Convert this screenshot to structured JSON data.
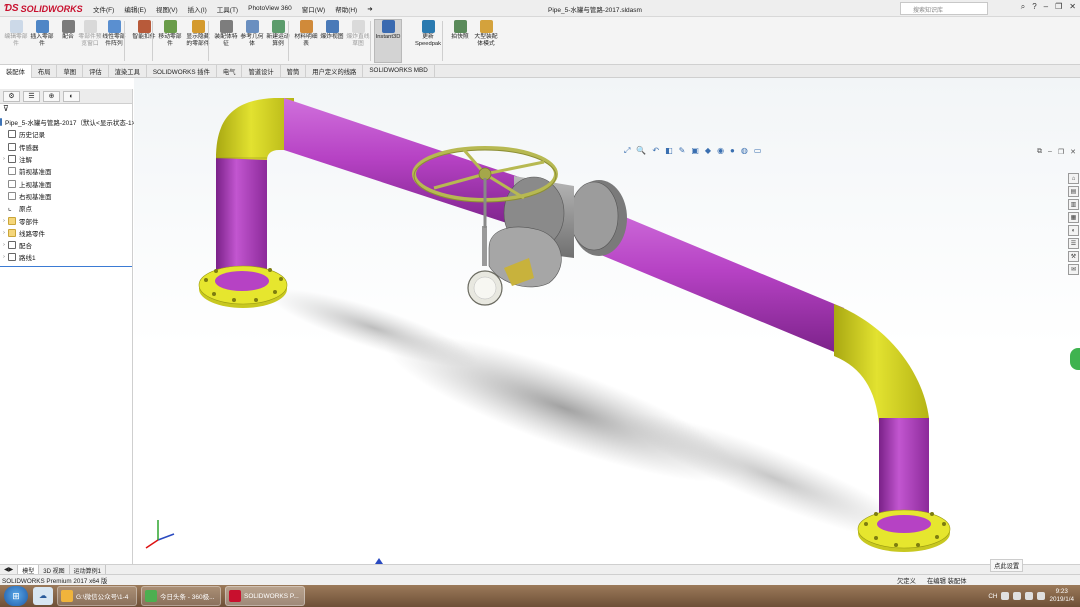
{
  "app": {
    "name": "SOLIDWORKS",
    "document_title": "Pipe_5-水罐与管路-2017.sldasm"
  },
  "menu": [
    "文件(F)",
    "编辑(E)",
    "视图(V)",
    "插入(I)",
    "工具(T)",
    "PhotoView 360",
    "窗口(W)",
    "帮助(H)"
  ],
  "search": {
    "placeholder": "搜索知识库"
  },
  "toolbar": [
    {
      "label": "编辑零部件",
      "icon": "edit-component-icon",
      "dim": true
    },
    {
      "label": "插入零部件",
      "icon": "insert-component-icon"
    },
    {
      "label": "配合",
      "icon": "mate-icon"
    },
    {
      "label": "零部件预览窗口",
      "icon": "component-preview-icon",
      "dim": true
    },
    {
      "label": "线性零部件阵列",
      "icon": "linear-pattern-icon"
    },
    {
      "label": "智能扣件",
      "icon": "smart-fastener-icon"
    },
    {
      "label": "移动零部件",
      "icon": "move-component-icon"
    },
    {
      "label": "显示隐藏的零部件",
      "icon": "show-hidden-icon"
    },
    {
      "label": "装配体特征",
      "icon": "assembly-feature-icon"
    },
    {
      "label": "参考几何体",
      "icon": "reference-geometry-icon"
    },
    {
      "label": "新建运动算例",
      "icon": "motion-study-icon"
    },
    {
      "label": "材料明细表",
      "icon": "bom-icon"
    },
    {
      "label": "爆炸视图",
      "icon": "exploded-view-icon"
    },
    {
      "label": "爆炸直线草图",
      "icon": "explode-line-icon",
      "dim": true
    },
    {
      "label": "Instant3D",
      "icon": "instant3d-icon",
      "active": true
    },
    {
      "label": "更新Speedpak",
      "icon": "speedpak-icon"
    },
    {
      "label": "拍快照",
      "icon": "snapshot-icon"
    },
    {
      "label": "大型装配体模式",
      "icon": "large-assembly-icon"
    }
  ],
  "tabs": [
    "装配体",
    "布局",
    "草图",
    "评估",
    "渲染工具",
    "SOLIDWORKS 插件",
    "电气",
    "管道设计",
    "管筒",
    "用户定义的线路",
    "SOLIDWORKS MBD"
  ],
  "tree": {
    "root": "Pipe_5-水罐与管路-2017（默认<显示状态-1>）",
    "items": [
      {
        "label": "历史记录",
        "icon": "history"
      },
      {
        "label": "传感器",
        "icon": "sensor"
      },
      {
        "label": "注解",
        "icon": "annotation",
        "expandable": true
      },
      {
        "label": "前视基准面",
        "icon": "plane"
      },
      {
        "label": "上视基准面",
        "icon": "plane"
      },
      {
        "label": "右视基准面",
        "icon": "plane"
      },
      {
        "label": "原点",
        "icon": "origin"
      },
      {
        "label": "零部件",
        "icon": "folder",
        "expandable": true
      },
      {
        "label": "线路零件",
        "icon": "folder",
        "expandable": true
      },
      {
        "label": "配合",
        "icon": "mate",
        "expandable": true
      },
      {
        "label": "路线1",
        "icon": "route",
        "expandable": true
      }
    ]
  },
  "model_tabs": [
    "模型",
    "3D 视图",
    "运动算例1"
  ],
  "tip": "点此设置",
  "status": {
    "product": "SOLIDWORKS Premium 2017 x64 版",
    "state1": "欠定义",
    "state2": "在编辑 装配体"
  },
  "taskbar": {
    "tasks": [
      {
        "label": "G:\\微信公众号\\1-4",
        "color": "#f0b43c"
      },
      {
        "label": "今日头条 - 360极...",
        "color": "#4caf50"
      },
      {
        "label": "SOLIDWORKS P...",
        "color": "#c8102e",
        "active": true
      }
    ],
    "time": "9:23",
    "date": "2019/1/4",
    "tray_text": "CH"
  },
  "colors": {
    "pipe": "#b642c4",
    "elbow": "#d4d41c",
    "flange": "#e0e02a",
    "valve": "#8e8e8e",
    "wheel": "#bdbf5a",
    "accent": "#c8102e"
  }
}
